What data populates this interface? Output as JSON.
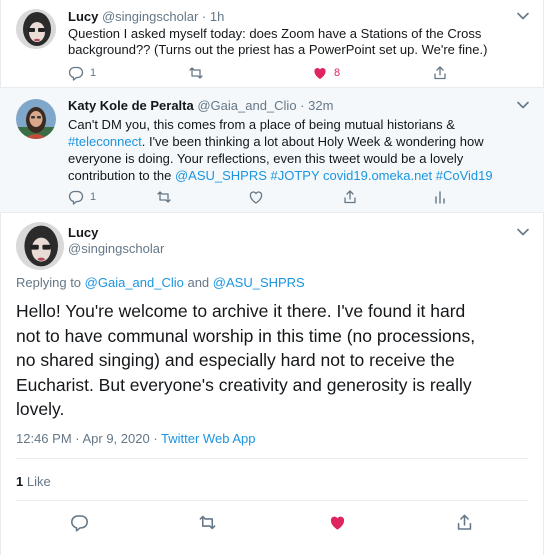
{
  "tweet1": {
    "name": "Lucy",
    "handle": "@singingscholar",
    "time": "· 1h",
    "text_line1": "Question I asked myself today: does Zoom have a Stations of the Cross",
    "text_line2": "background?? (Turns out the priest has a PowerPoint set up. We're fine.)",
    "reply_count": "1",
    "like_count": "8",
    "liked": true
  },
  "tweet2": {
    "name": "Katy Kole de Peralta",
    "handle": "@Gaia_and_Clio",
    "time": "· 32m",
    "line1": "Can't DM you, this comes from a place of being mutual historians &",
    "line2_link": "#teleconnect",
    "line2_rest": ". I've been thinking a lot about Holy Week & wondering how",
    "line3": "everyone is doing. Your reflections, even this tweet would be a lovely",
    "line4_text": "contribution to the ",
    "line4_link": "@ASU_SHPRS #JOTPY covid19.omeka.net #CoVid19",
    "reply_count": "1"
  },
  "tweet3": {
    "name": "Lucy",
    "handle": "@singingscholar",
    "replying_prefix": "Replying to ",
    "replying_user1": "@Gaia_and_Clio",
    "replying_and": " and ",
    "replying_user2": "@ASU_SHPRS",
    "body_line1": "Hello! You're welcome to archive it there. I've found it hard",
    "body_line2": "not to have communal worship in this time (no processions,",
    "body_line3": "no shared singing) and especially hard not to receive the",
    "body_line4": "Eucharist. But everyone's creativity and generosity is really",
    "body_line5": "lovely.",
    "timestamp": "12:46 PM · Apr 9, 2020",
    "source_sep": " · ",
    "source": "Twitter Web App",
    "likes_count": "1",
    "likes_label": " Like",
    "liked": true
  },
  "colors": {
    "link": "#1b95e0",
    "like": "#e0245e",
    "secondary_text": "#657786",
    "border": "#e6ecf0",
    "highlight_bg": "#f5f8fa"
  },
  "icons": [
    "chevron-down-icon",
    "reply-icon",
    "retweet-icon",
    "heart-icon",
    "share-icon",
    "analytics-icon"
  ]
}
